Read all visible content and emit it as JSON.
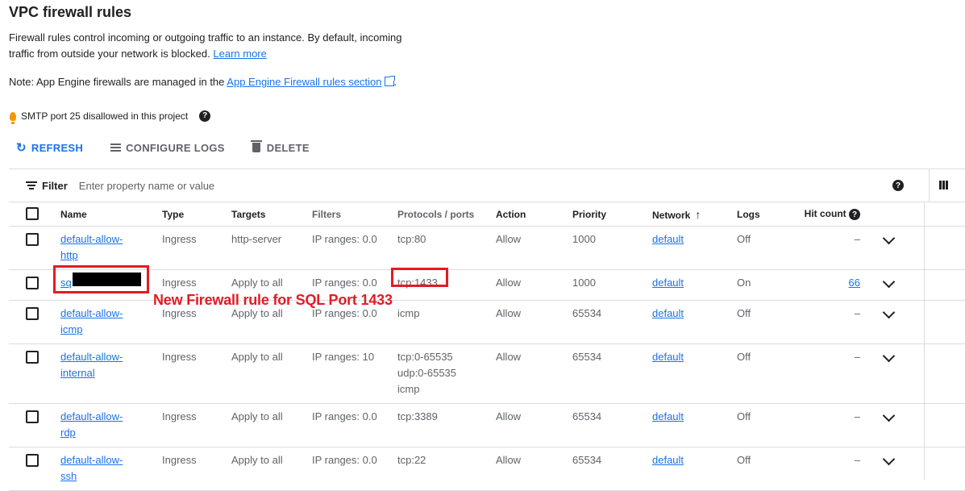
{
  "page": {
    "title": "VPC firewall rules",
    "description": "Firewall rules control incoming or outgoing traffic to an instance. By default, incoming traffic from outside your network is blocked.",
    "learn_more": "Learn more",
    "note_prefix": "Note: App Engine firewalls are managed in the ",
    "note_link": "App Engine Firewall rules section",
    "note_suffix": ".",
    "smtp_notice": "SMTP port 25 disallowed in this project"
  },
  "toolbar": {
    "refresh": "REFRESH",
    "configure_logs": "CONFIGURE LOGS",
    "delete": "DELETE"
  },
  "filter": {
    "label": "Filter",
    "placeholder": "Enter property name or value"
  },
  "table": {
    "headers": {
      "name": "Name",
      "type": "Type",
      "targets": "Targets",
      "filters": "Filters",
      "protocols": "Protocols / ports",
      "action": "Action",
      "priority": "Priority",
      "network": "Network",
      "logs": "Logs",
      "hit_count": "Hit count"
    },
    "rows": [
      {
        "name": "default-allow-http",
        "name_l1": "default-allow-",
        "name_l2": "http",
        "type": "Ingress",
        "targets": "http-server",
        "filters": "IP ranges: 0.0",
        "protocols": [
          "tcp:80"
        ],
        "action": "Allow",
        "priority": "1000",
        "network": "default",
        "logs": "Off",
        "hit_count": "–"
      },
      {
        "name": "sq",
        "name_l1": "sq",
        "name_l2": "",
        "type": "Ingress",
        "targets": "Apply to all",
        "filters": "IP ranges: 0.0",
        "protocols": [
          "tcp:1433"
        ],
        "action": "Allow",
        "priority": "1000",
        "network": "default",
        "logs": "On",
        "hit_count": "66"
      },
      {
        "name": "default-allow-icmp",
        "name_l1": "default-allow-",
        "name_l2": "icmp",
        "type": "Ingress",
        "targets": "Apply to all",
        "filters": "IP ranges: 0.0",
        "protocols": [
          "icmp"
        ],
        "action": "Allow",
        "priority": "65534",
        "network": "default",
        "logs": "Off",
        "hit_count": "–"
      },
      {
        "name": "default-allow-internal",
        "name_l1": "default-allow-",
        "name_l2": "internal",
        "type": "Ingress",
        "targets": "Apply to all",
        "filters": "IP ranges: 10",
        "protocols": [
          "tcp:0-65535",
          "udp:0-65535",
          "icmp"
        ],
        "action": "Allow",
        "priority": "65534",
        "network": "default",
        "logs": "Off",
        "hit_count": "–"
      },
      {
        "name": "default-allow-rdp",
        "name_l1": "default-allow-",
        "name_l2": "rdp",
        "type": "Ingress",
        "targets": "Apply to all",
        "filters": "IP ranges: 0.0",
        "protocols": [
          "tcp:3389"
        ],
        "action": "Allow",
        "priority": "65534",
        "network": "default",
        "logs": "Off",
        "hit_count": "–"
      },
      {
        "name": "default-allow-ssh",
        "name_l1": "default-allow-",
        "name_l2": "ssh",
        "type": "Ingress",
        "targets": "Apply to all",
        "filters": "IP ranges: 0.0",
        "protocols": [
          "tcp:22"
        ],
        "action": "Allow",
        "priority": "65534",
        "network": "default",
        "logs": "Off",
        "hit_count": "–"
      }
    ]
  },
  "annotation": {
    "text": "New Firewall rule for SQL Port 1433",
    "color": "#e31b23"
  },
  "colors": {
    "link": "#1a73e8",
    "warning": "#f29900"
  }
}
